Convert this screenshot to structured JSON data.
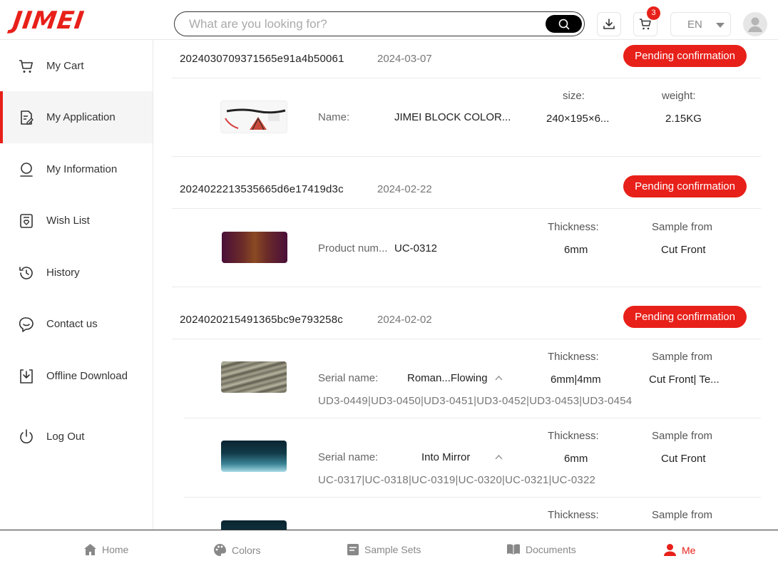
{
  "header": {
    "logo": "JIMEI",
    "search_placeholder": "What are you looking for?",
    "cart_badge": "3",
    "language": "EN"
  },
  "sidebar": {
    "items": [
      {
        "label": "My Cart",
        "icon": "cart-icon"
      },
      {
        "label": "My Application",
        "icon": "application-icon",
        "active": true
      },
      {
        "label": "My Information",
        "icon": "user-icon"
      },
      {
        "label": "Wish List",
        "icon": "wishlist-icon"
      },
      {
        "label": "History",
        "icon": "history-icon"
      },
      {
        "label": "Contact us",
        "icon": "chat-icon"
      },
      {
        "label": "Offline Download",
        "icon": "download-icon"
      },
      {
        "label": "Log Out",
        "icon": "power-icon"
      }
    ]
  },
  "orders": [
    {
      "id": "2024030709371565e91a4b50061",
      "date": "2024-03-07",
      "status": "Pending confirmation",
      "item": {
        "label": "Name:",
        "value": "JIMEI BLOCK COLOR...",
        "col1_head": "size:",
        "col1_val": "240×195×6...",
        "col2_head": "weight:",
        "col2_val": "2.15KG"
      }
    },
    {
      "id": "2024022213535665d6e17419d3c",
      "date": "2024-02-22",
      "status": "Pending confirmation",
      "item": {
        "label": "Product num...",
        "value": "UC-0312",
        "col1_head": "Thickness:",
        "col1_val": "6mm",
        "col2_head": "Sample from",
        "col2_val": "Cut Front"
      }
    },
    {
      "id": "2024020215491365bc9e793258c",
      "date": "2024-02-02",
      "status": "Pending confirmation",
      "items": [
        {
          "label": "Serial name:",
          "value": "Roman...Flowing",
          "col1_head": "Thickness:",
          "col1_val": "6mm|4mm",
          "col2_head": "Sample from",
          "col2_val": "Cut Front| Te...",
          "codes": "UD3-0449|UD3-0450|UD3-0451|UD3-0452|UD3-0453|UD3-0454"
        },
        {
          "label": "Serial name:",
          "value": "Into Mirror",
          "col1_head": "Thickness:",
          "col1_val": "6mm",
          "col2_head": "Sample from",
          "col2_val": "Cut Front",
          "codes": "UC-0317|UC-0318|UC-0319|UC-0320|UC-0321|UC-0322"
        },
        {
          "col1_head": "Thickness:",
          "col2_head": "Sample from"
        }
      ]
    }
  ],
  "bottom_nav": [
    {
      "label": "Home",
      "icon": "home-icon"
    },
    {
      "label": "Colors",
      "icon": "palette-icon"
    },
    {
      "label": "Sample Sets",
      "icon": "sample-sets-icon"
    },
    {
      "label": "Documents",
      "icon": "documents-icon"
    },
    {
      "label": "Me",
      "icon": "me-icon",
      "active": true
    }
  ],
  "colors": {
    "accent": "#e8201a",
    "text": "#333333",
    "muted": "#888888"
  }
}
